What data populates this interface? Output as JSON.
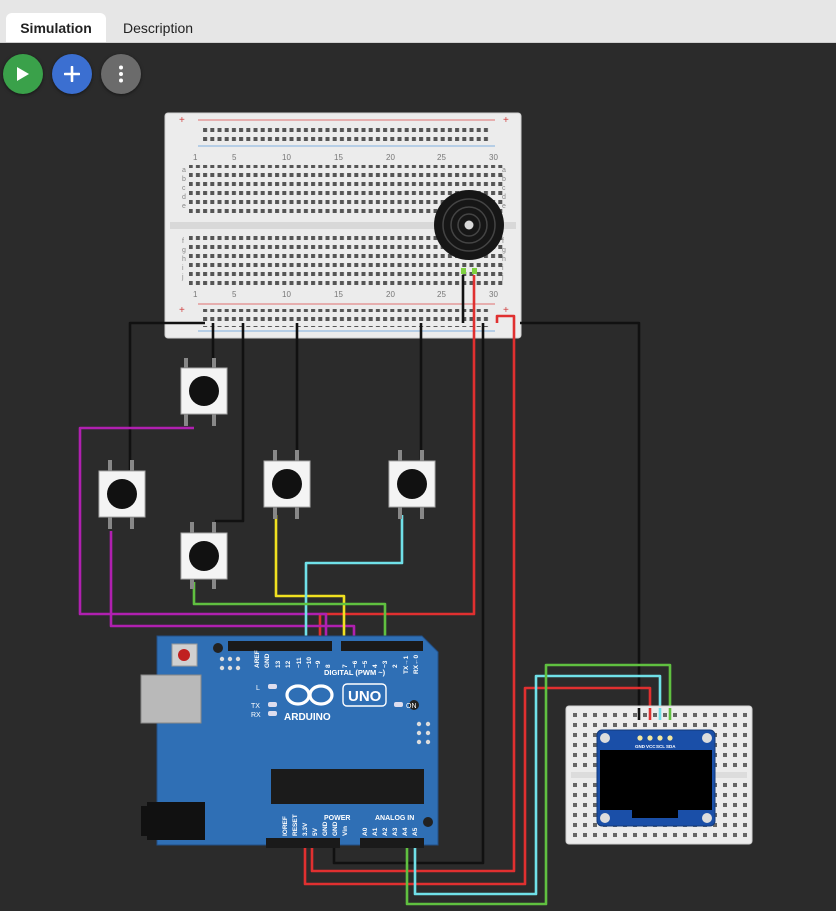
{
  "tabs": [
    {
      "label": "Simulation",
      "active": true
    },
    {
      "label": "Description",
      "active": false
    }
  ],
  "toolbar": {
    "play_icon": "play-icon",
    "add_icon": "plus-icon",
    "more_icon": "more-vertical-icon"
  },
  "breadboard": {
    "column_numbers": [
      "1",
      "5",
      "10",
      "15",
      "20",
      "25",
      "30"
    ],
    "row_letters_top": [
      "a",
      "b",
      "c",
      "d",
      "e"
    ],
    "row_letters_bottom": [
      "f",
      "g",
      "h",
      "i",
      "j"
    ],
    "plus": "+",
    "minus": "−"
  },
  "arduino": {
    "brand": "ARDUINO",
    "model": "UNO",
    "digital_label": "DIGITAL (PWM ~)",
    "analog_label": "ANALOG IN",
    "power_label": "POWER",
    "led_l": "L",
    "led_tx": "TX",
    "led_rx": "RX",
    "led_on": "ON",
    "digital_pins": [
      "AREF",
      "GND",
      "13",
      "12",
      "~11",
      "~10",
      "~9",
      "8",
      "7",
      "~6",
      "~5",
      "4",
      "~3",
      "2",
      "TX→1",
      "RX←0"
    ],
    "power_pins": [
      "IOREF",
      "RESET",
      "3.3V",
      "5V",
      "GND",
      "GND",
      "Vin"
    ],
    "analog_pins": [
      "A0",
      "A1",
      "A2",
      "A3",
      "A4",
      "A5"
    ]
  },
  "oled": {
    "pins": [
      "GND",
      "VCC",
      "SCL",
      "SDA"
    ]
  },
  "colors": {
    "background": "#2b2b2b",
    "wire_black": "#111111",
    "wire_red": "#e03030",
    "wire_purple": "#b020b0",
    "wire_yellow": "#f0e020",
    "wire_cyan": "#70e0e8",
    "wire_green": "#60c040",
    "arduino_blue": "#2f6fb5"
  }
}
